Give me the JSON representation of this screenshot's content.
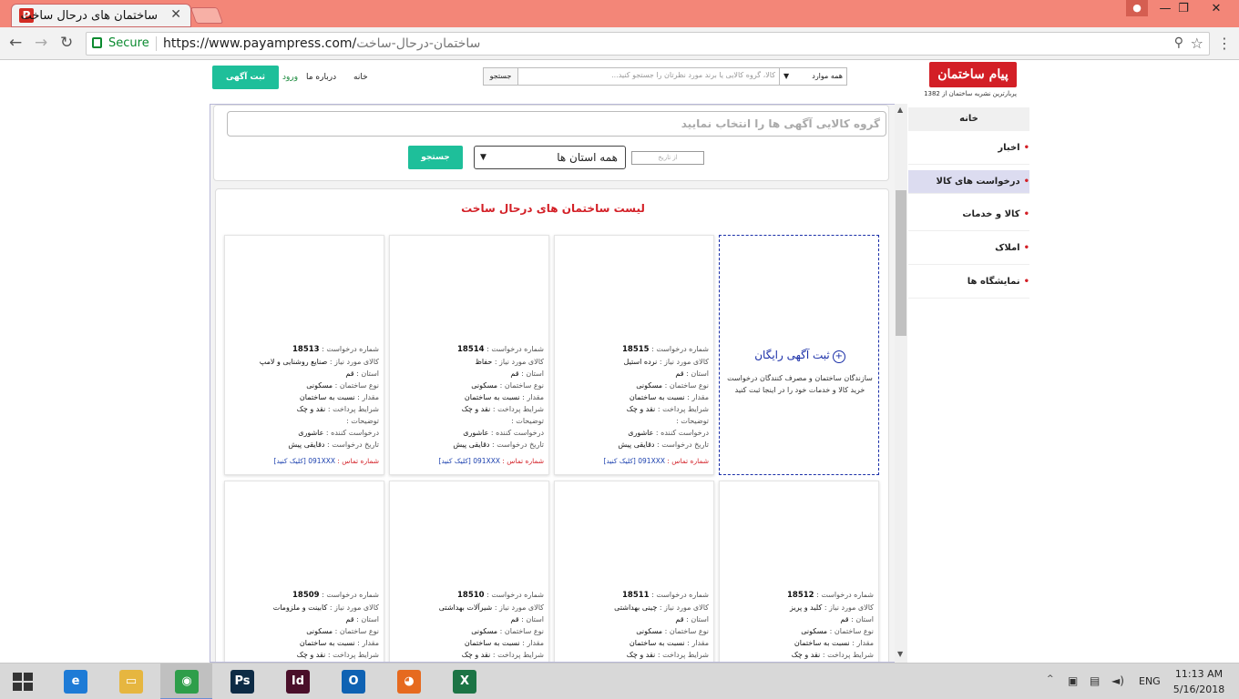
{
  "browser": {
    "tab_title": "ساختمان های درحال ساخت",
    "tab_favicon": "P",
    "close_glyph": "✕",
    "secure_label": "Secure",
    "url_host": "https://www.payampress.com/",
    "url_path": "ساختمان-درحال-ساخت",
    "win_buttons": {
      "minimize": "—",
      "restore": "❐",
      "close": "✕"
    },
    "nav_glyphs": {
      "back": "←",
      "forward": "→",
      "reload": "↻"
    }
  },
  "header": {
    "logo_text": "پیام ساختمان",
    "logo_tagline": "پربارترین نشریه ساختمان از 1382",
    "search_button": "جستجو",
    "search_placeholder": "کالا، گروه کالایی یا برند مورد نظرتان را جستجو کنید...",
    "category_select": "همه موارد",
    "nav_home": "خانه",
    "nav_about": "درباره ما",
    "nav_login": "ورود",
    "free_ad_button": "ثبت آگهی رایگان"
  },
  "sidebar": {
    "home": "خانه",
    "items": [
      {
        "label": "اخبار",
        "active": false
      },
      {
        "label": "درخواست های کالا",
        "active": true
      },
      {
        "label": "کالا و خدمات",
        "active": false
      },
      {
        "label": "املاک",
        "active": false
      },
      {
        "label": "نمایشگاه ها",
        "active": false
      }
    ]
  },
  "filter": {
    "group_placeholder": "گروه کالایی آگهی ها را انتخاب نمایید",
    "date_from_placeholder": "از تاریخ",
    "province_select": "همه استان ها",
    "search_button": "جستجو"
  },
  "list": {
    "title": "لیست ساختمان های درحال ساخت",
    "add_card": {
      "title": "ثبت آگهی رایگان",
      "description": "سازندگان ساختمان و مصرف کنندگان درخواست خرید کالا و خدمات خود را در اینجا ثبت کنید"
    },
    "labels": {
      "request_no": "شماره درخواست :",
      "goods": "کالای مورد نیاز :",
      "province": "استان :",
      "building_type": "نوع ساختمان :",
      "amount": "مقدار :",
      "payment": "شرایط پرداخت :",
      "description": "توضیحات :",
      "requester": "درخواست کننده :",
      "request_date": "تاریخ درخواست :",
      "contact": "شماره تماس :",
      "click": "[کلیک کنید]"
    },
    "row1": [
      {
        "no": "18515",
        "goods": "نرده استیل",
        "province": "قم",
        "type": "مسکونی",
        "amount": "نسبت به ساختمان",
        "payment": "نقد و چک",
        "requester": "عاشوری",
        "date": "دقایقی پیش",
        "phone": "091XXX"
      },
      {
        "no": "18514",
        "goods": "حفاظ",
        "province": "قم",
        "type": "مسکونی",
        "amount": "نسبت به ساختمان",
        "payment": "نقد و چک",
        "requester": "عاشوری",
        "date": "دقایقی پیش",
        "phone": "091XXX"
      },
      {
        "no": "18513",
        "goods": "صنایع روشنایی و لامپ",
        "province": "قم",
        "type": "مسکونی",
        "amount": "نسبت به ساختمان",
        "payment": "نقد و چک",
        "requester": "عاشوری",
        "date": "دقایقی پیش",
        "phone": "091XXX"
      }
    ],
    "row2": [
      {
        "no": "18512",
        "goods": "کلید و پریز",
        "province": "قم",
        "type": "مسکونی",
        "amount": "نسبت به ساختمان",
        "payment": "نقد و چک"
      },
      {
        "no": "18511",
        "goods": "چینی بهداشتی",
        "province": "قم",
        "type": "مسکونی",
        "amount": "نسبت به ساختمان",
        "payment": "نقد و چک"
      },
      {
        "no": "18510",
        "goods": "شیرآلات بهداشتی",
        "province": "قم",
        "type": "مسکونی",
        "amount": "نسبت به ساختمان",
        "payment": "نقد و چک"
      },
      {
        "no": "18509",
        "goods": "کابینت و ملزومات",
        "province": "قم",
        "type": "مسکونی",
        "amount": "نسبت به ساختمان",
        "payment": "نقد و چک"
      }
    ]
  },
  "taskbar": {
    "apps": [
      {
        "name": "ie-icon",
        "glyph": "e",
        "color": "#1e7bd6"
      },
      {
        "name": "file-explorer-icon",
        "glyph": "▭",
        "color": "#e6b640"
      },
      {
        "name": "chrome-icon",
        "glyph": "◉",
        "color": "#2e9e4a"
      },
      {
        "name": "photoshop-icon",
        "glyph": "Ps",
        "color": "#0d2b45"
      },
      {
        "name": "indesign-icon",
        "glyph": "Id",
        "color": "#4a0f2a"
      },
      {
        "name": "outlook-icon",
        "glyph": "O",
        "color": "#0f62b3"
      },
      {
        "name": "firefox-icon",
        "glyph": "◕",
        "color": "#e66a1f"
      },
      {
        "name": "excel-icon",
        "glyph": "X",
        "color": "#1c7445"
      }
    ],
    "lang": "ENG",
    "time": "11:13 AM",
    "date": "5/16/2018",
    "tray_arrow": "^"
  }
}
